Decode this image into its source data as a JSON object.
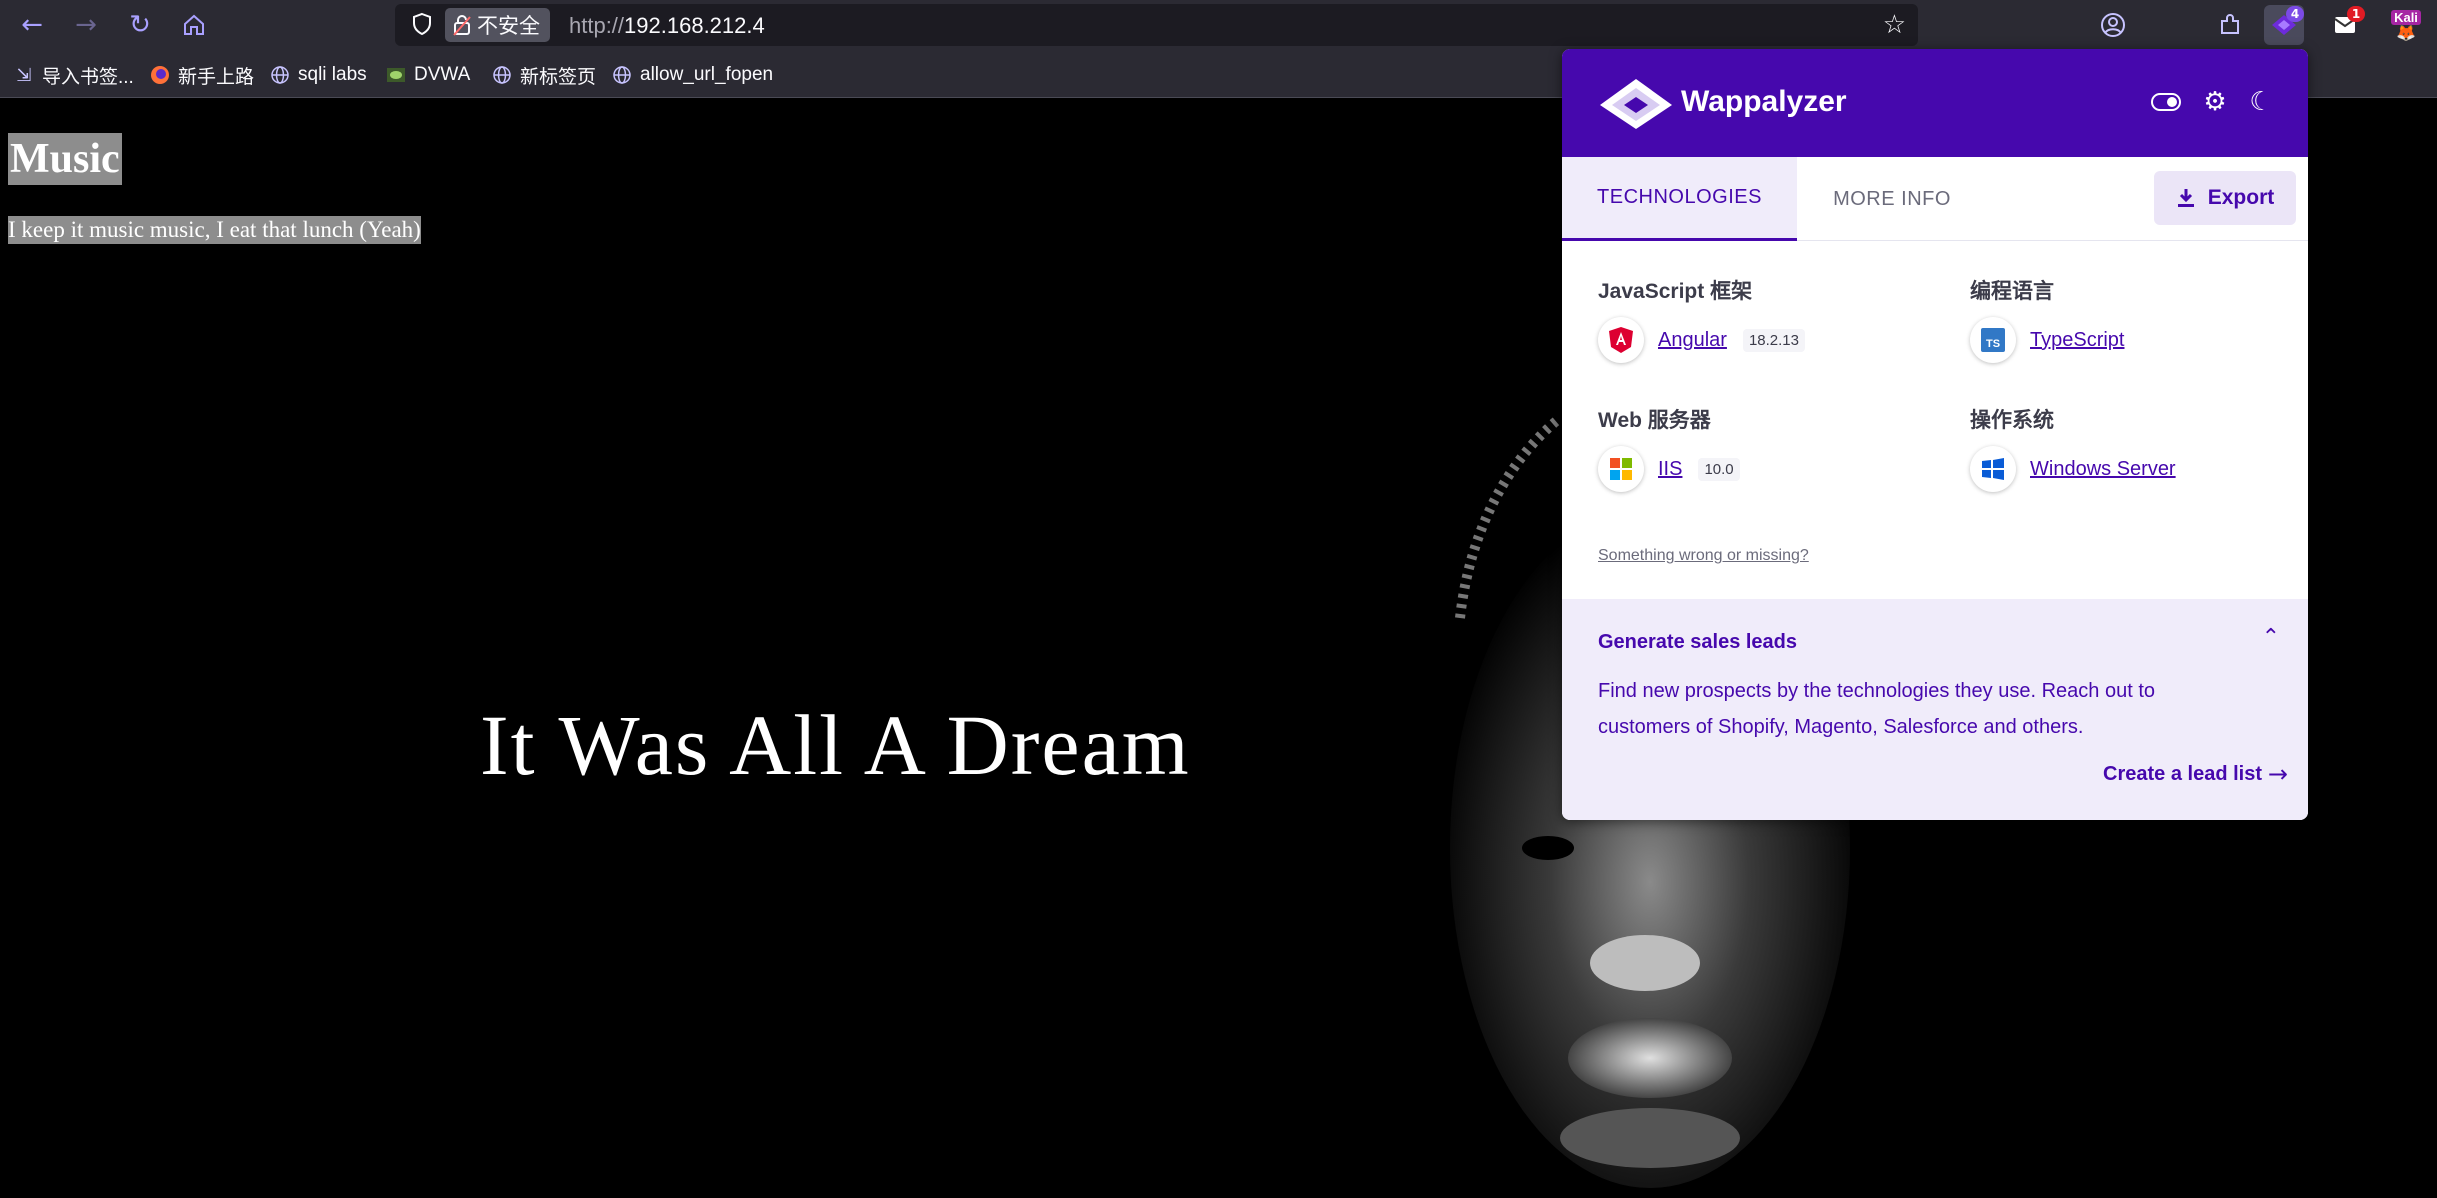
{
  "browser": {
    "security_label": "不安全",
    "url_protocol": "http://",
    "url_host": "192.168.212.4",
    "extensions": {
      "wappalyzer_badge": "4",
      "mail_badge": "1",
      "profile_label": "Kali"
    }
  },
  "bookmarks": [
    {
      "label": "导入书签...",
      "icon": "import-icon"
    },
    {
      "label": "新手上路",
      "icon": "firefox-icon"
    },
    {
      "label": "sqli labs",
      "icon": "globe-icon"
    },
    {
      "label": "DVWA",
      "icon": "dvwa-icon"
    },
    {
      "label": "新标签页",
      "icon": "globe-icon"
    },
    {
      "label": "allow_url_fopen",
      "icon": "globe-icon"
    }
  ],
  "page": {
    "title": "Music",
    "lyric": "I keep it music music, I eat that lunch (Yeah)",
    "tagline": "It Was All A Dream"
  },
  "wappalyzer": {
    "brand": "Wappalyzer",
    "tabs": [
      "TECHNOLOGIES",
      "MORE INFO"
    ],
    "export_label": "Export",
    "categories": [
      {
        "name": "JavaScript 框架",
        "tech": "Angular",
        "version": "18.2.13",
        "icon": "angular-icon"
      },
      {
        "name": "编程语言",
        "tech": "TypeScript",
        "version": "",
        "icon": "typescript-icon"
      },
      {
        "name": "Web 服务器",
        "tech": "IIS",
        "version": "10.0",
        "icon": "iis-icon"
      },
      {
        "name": "操作系统",
        "tech": "Windows Server",
        "version": "",
        "icon": "windows-icon"
      }
    ],
    "report_link": "Something wrong or missing?",
    "leads": {
      "title": "Generate sales leads",
      "description": "Find new prospects by the technologies they use. Reach out to customers of Shopify, Magento, Salesforce and others.",
      "cta": "Create a lead list"
    }
  },
  "colors": {
    "wappalyzer_purple": "#4608ad",
    "toolbar_bg": "#2b2a33",
    "page_bg": "#000000"
  }
}
